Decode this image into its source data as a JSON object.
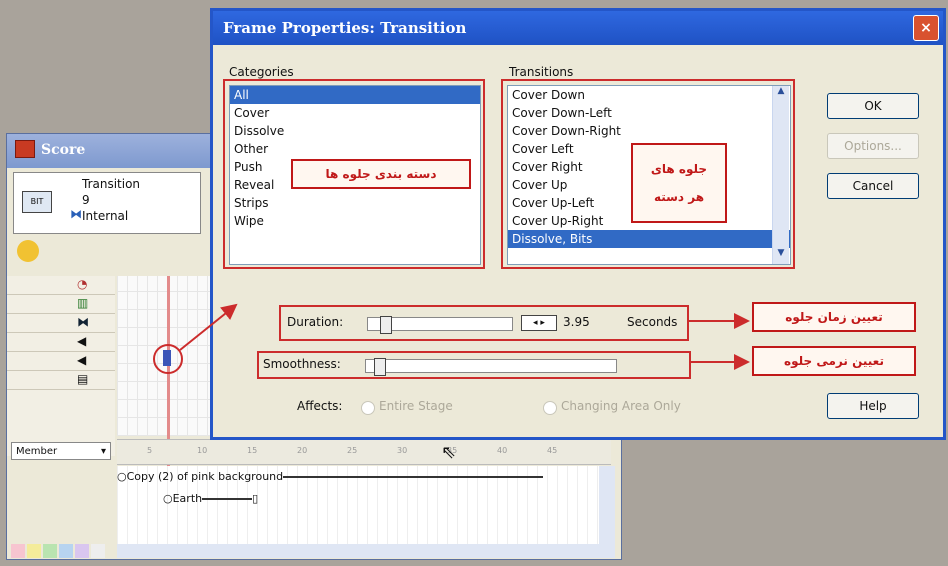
{
  "score": {
    "title": "Score",
    "info": {
      "line1": "Transition",
      "line2": "9",
      "line3": "Internal",
      "thumb": "BIT"
    },
    "member_dropdown": "Member",
    "sprites": [
      "Copy (2) of pink background",
      "Earth"
    ],
    "channel_icons": [
      "tempo-icon",
      "palette-icon",
      "transition-icon",
      "sound-1-icon",
      "sound-2-icon",
      "script-icon"
    ]
  },
  "dialog": {
    "title": "Frame Properties: Transition",
    "close": "×",
    "categories_label": "Categories",
    "categories": [
      "All",
      "Cover",
      "Dissolve",
      "Other",
      "Push",
      "Reveal",
      "Strips",
      "Wipe"
    ],
    "selected_category": "All",
    "transitions_label": "Transitions",
    "transitions": [
      "Cover Down",
      "Cover Down-Left",
      "Cover Down-Right",
      "Cover Left",
      "Cover Right",
      "Cover Up",
      "Cover Up-Left",
      "Cover Up-Right",
      "Dissolve, Bits"
    ],
    "selected_transition": "Dissolve, Bits",
    "ok": "OK",
    "options": "Options...",
    "cancel": "Cancel",
    "help": "Help",
    "duration_label": "Duration:",
    "duration_value": "3.95",
    "duration_unit": "Seconds",
    "smoothness_label": "Smoothness:",
    "affects_label": "Affects:",
    "entire_stage": "Entire Stage",
    "changing_area": "Changing Area Only"
  },
  "annotations": {
    "categories": "دسته بندی جلوه ها",
    "transitions_line1": "جلوه های",
    "transitions_line2": "هر دسته",
    "duration": "تعیین زمان جلوه",
    "smoothness": "تعیین نرمی جلوه"
  },
  "colors": {
    "annotation": "#cc2c2c",
    "selection": "#316ac5",
    "title_bar": "#1f52c4"
  }
}
